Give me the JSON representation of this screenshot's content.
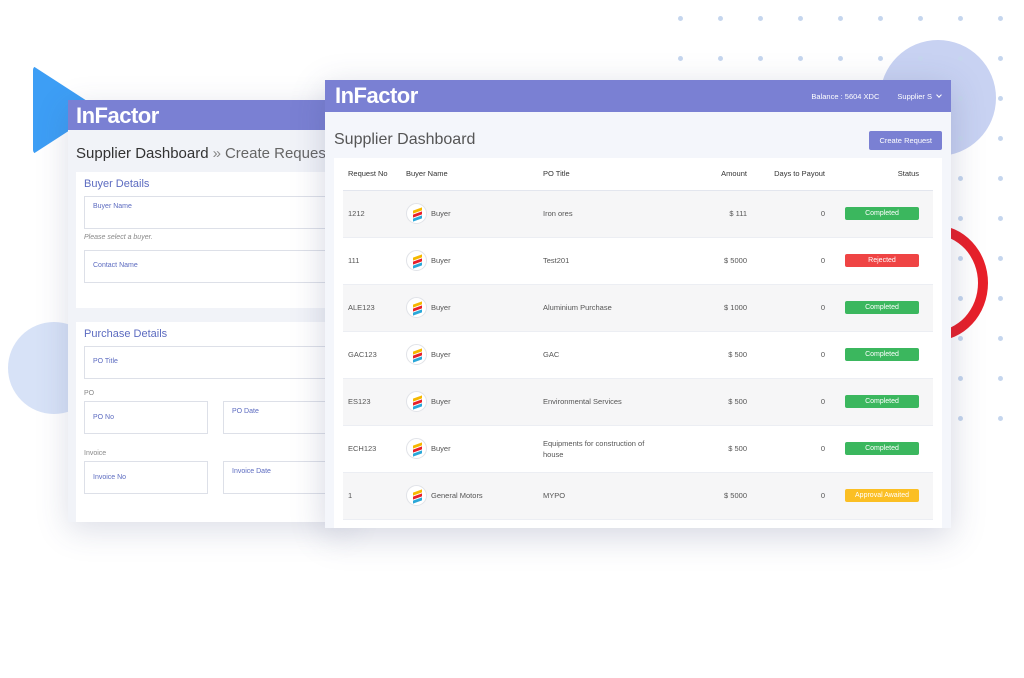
{
  "colors": {
    "header": "#7a80d3",
    "accent_text": "#5c6bc0",
    "completed": "#3bb75e",
    "rejected": "#ef4444",
    "approval_awaited": "#fbbf24"
  },
  "back_window": {
    "brand": "InFactor",
    "breadcrumb": [
      "Supplier Dashboard",
      "»",
      "Create Request"
    ],
    "buyer_details": {
      "title": "Buyer Details",
      "buyer_name_placeholder": "Buyer Name",
      "buyer_hint": "Please select a buyer.",
      "contact_name_placeholder": "Contact Name"
    },
    "purchase_details": {
      "title": "Purchase Details",
      "po_title_placeholder": "PO Title",
      "po_label": "PO",
      "po_no_placeholder": "PO No",
      "po_date_placeholder": "PO Date",
      "invoice_label": "Invoice",
      "invoice_no_placeholder": "Invoice No",
      "invoice_date_placeholder": "Invoice Date"
    }
  },
  "front_window": {
    "brand": "InFactor",
    "balance": "Balance : 5604 XDC",
    "user_menu": "Supplier S",
    "page_title": "Supplier Dashboard",
    "create_button": "Create Request",
    "table": {
      "headers": [
        "Request No",
        "Buyer Name",
        "PO Title",
        "Amount",
        "Days to Payout",
        "Status"
      ],
      "rows": [
        {
          "request_no": "1212",
          "buyer": "Buyer",
          "po_title": "Iron ores",
          "amount": "$ 111",
          "days": "0",
          "status": "Completed",
          "status_type": "completed"
        },
        {
          "request_no": "111",
          "buyer": "Buyer",
          "po_title": "Test201",
          "amount": "$ 5000",
          "days": "0",
          "status": "Rejected",
          "status_type": "rejected"
        },
        {
          "request_no": "ALE123",
          "buyer": "Buyer",
          "po_title": "Aluminium Purchase",
          "amount": "$ 1000",
          "days": "0",
          "status": "Completed",
          "status_type": "completed"
        },
        {
          "request_no": "GAC123",
          "buyer": "Buyer",
          "po_title": "GAC",
          "amount": "$ 500",
          "days": "0",
          "status": "Completed",
          "status_type": "completed"
        },
        {
          "request_no": "ES123",
          "buyer": "Buyer",
          "po_title": "Environmental Services",
          "amount": "$ 500",
          "days": "0",
          "status": "Completed",
          "status_type": "completed"
        },
        {
          "request_no": "ECH123",
          "buyer": "Buyer",
          "po_title": "Equipments for construction of house",
          "amount": "$ 500",
          "days": "0",
          "status": "Completed",
          "status_type": "completed"
        },
        {
          "request_no": "1",
          "buyer": "General Motors",
          "po_title": "MYPO",
          "amount": "$ 5000",
          "days": "0",
          "status": "Approval Awaited",
          "status_type": "approval_awaited"
        }
      ]
    }
  }
}
